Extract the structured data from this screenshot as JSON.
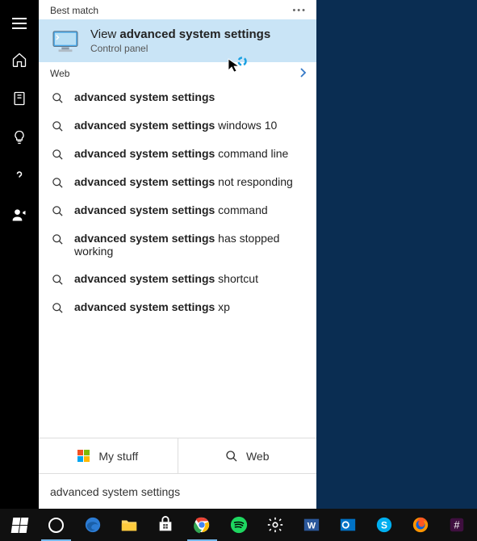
{
  "sections": {
    "best_match_label": "Best match",
    "web_label": "Web"
  },
  "best_match": {
    "title_pre": "View ",
    "title_bold": "advanced system settings",
    "subtitle": "Control panel"
  },
  "web_results": [
    {
      "bold": "advanced system settings",
      "rest": ""
    },
    {
      "bold": "advanced system settings",
      "rest": " windows 10"
    },
    {
      "bold": "advanced system settings",
      "rest": " command line"
    },
    {
      "bold": "advanced system settings",
      "rest": " not responding"
    },
    {
      "bold": "advanced system settings",
      "rest": " command"
    },
    {
      "bold": "advanced system settings",
      "rest": " has stopped working"
    },
    {
      "bold": "advanced system settings",
      "rest": " shortcut"
    },
    {
      "bold": "advanced system settings",
      "rest": " xp"
    }
  ],
  "tabs": {
    "my_stuff": "My stuff",
    "web": "Web"
  },
  "search": {
    "value": "advanced system settings",
    "placeholder": "Search"
  },
  "rail": {
    "items": [
      "menu",
      "home",
      "notebook",
      "lightbulb",
      "help",
      "feedback"
    ]
  },
  "taskbar": {
    "items": [
      "start",
      "cortana",
      "edge",
      "explorer",
      "store",
      "chrome",
      "spotify",
      "settings",
      "word",
      "outlook",
      "skype",
      "firefox",
      "slack"
    ]
  }
}
